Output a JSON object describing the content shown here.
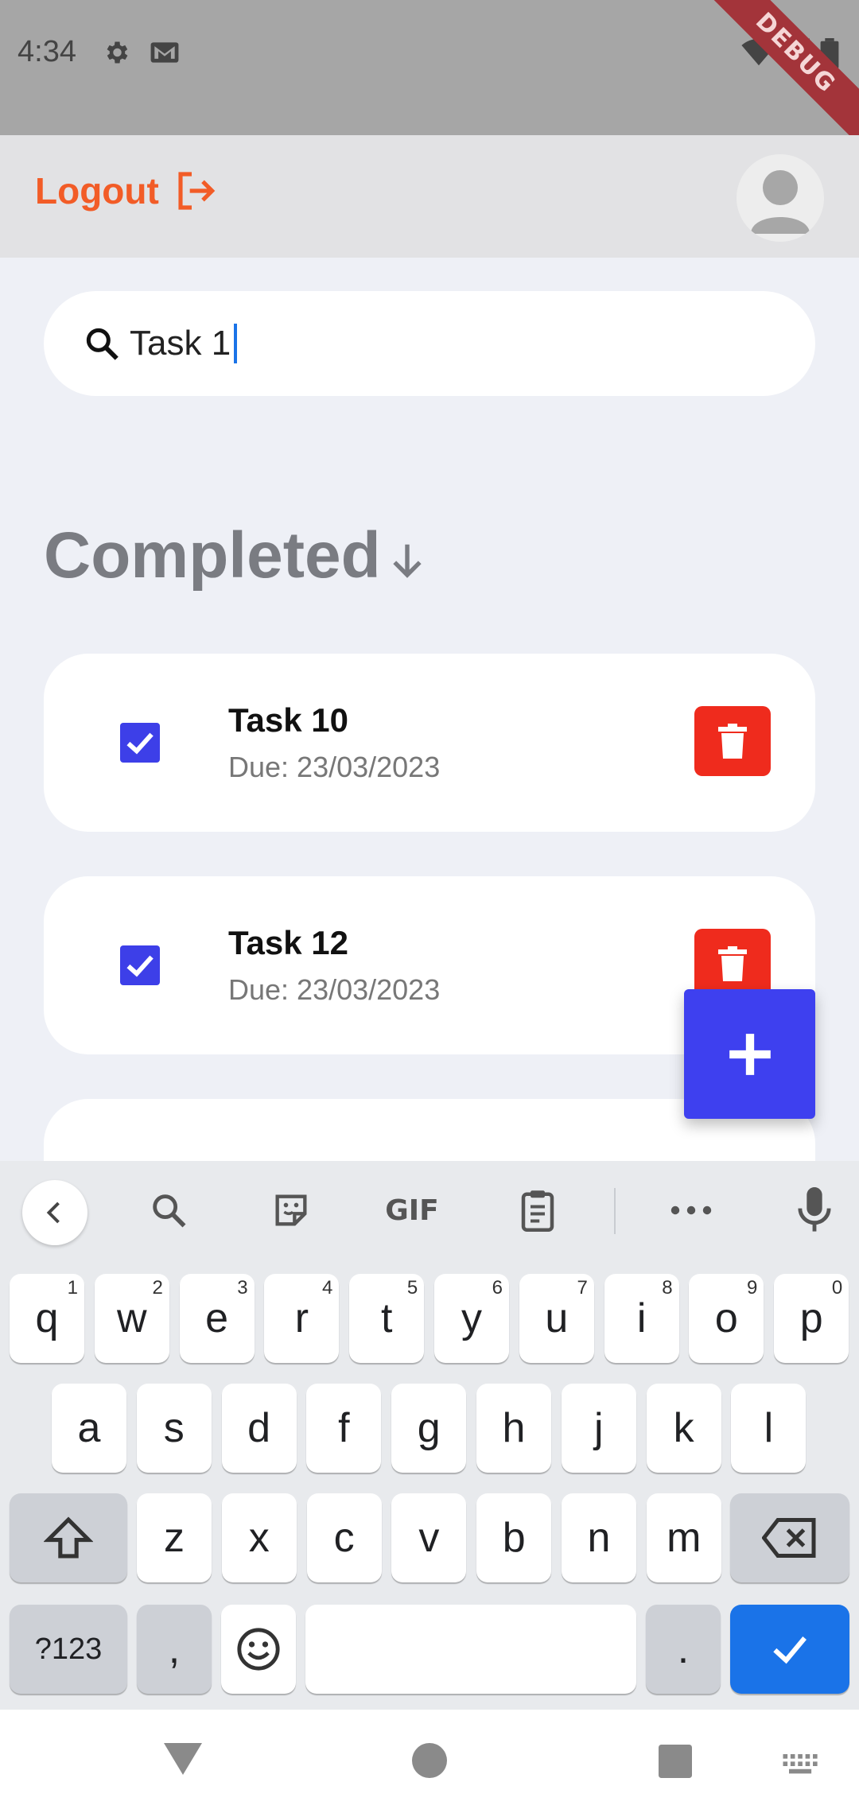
{
  "status": {
    "time": "4:34",
    "debug": "DEBUG"
  },
  "appbar": {
    "logout_label": "Logout"
  },
  "search": {
    "value": "Task 1"
  },
  "section": {
    "title": "Completed"
  },
  "tasks": [
    {
      "title": "Task 10",
      "due": "Due: 23/03/2023",
      "checked": true
    },
    {
      "title": "Task 12",
      "due": "Due: 23/03/2023",
      "checked": true
    }
  ],
  "colors": {
    "accent": "#3e40ef",
    "logout": "#f25c27",
    "delete": "#ef2b1d",
    "keyboard_enter": "#1a73e8"
  },
  "keyboard": {
    "row1": [
      {
        "k": "q",
        "h": "1"
      },
      {
        "k": "w",
        "h": "2"
      },
      {
        "k": "e",
        "h": "3"
      },
      {
        "k": "r",
        "h": "4"
      },
      {
        "k": "t",
        "h": "5"
      },
      {
        "k": "y",
        "h": "6"
      },
      {
        "k": "u",
        "h": "7"
      },
      {
        "k": "i",
        "h": "8"
      },
      {
        "k": "o",
        "h": "9"
      },
      {
        "k": "p",
        "h": "0"
      }
    ],
    "row2": [
      "a",
      "s",
      "d",
      "f",
      "g",
      "h",
      "j",
      "k",
      "l"
    ],
    "row3": [
      "z",
      "x",
      "c",
      "v",
      "b",
      "n",
      "m"
    ],
    "sym_label": "?123",
    "comma": ",",
    "period": ".",
    "gif_label": "GIF"
  }
}
